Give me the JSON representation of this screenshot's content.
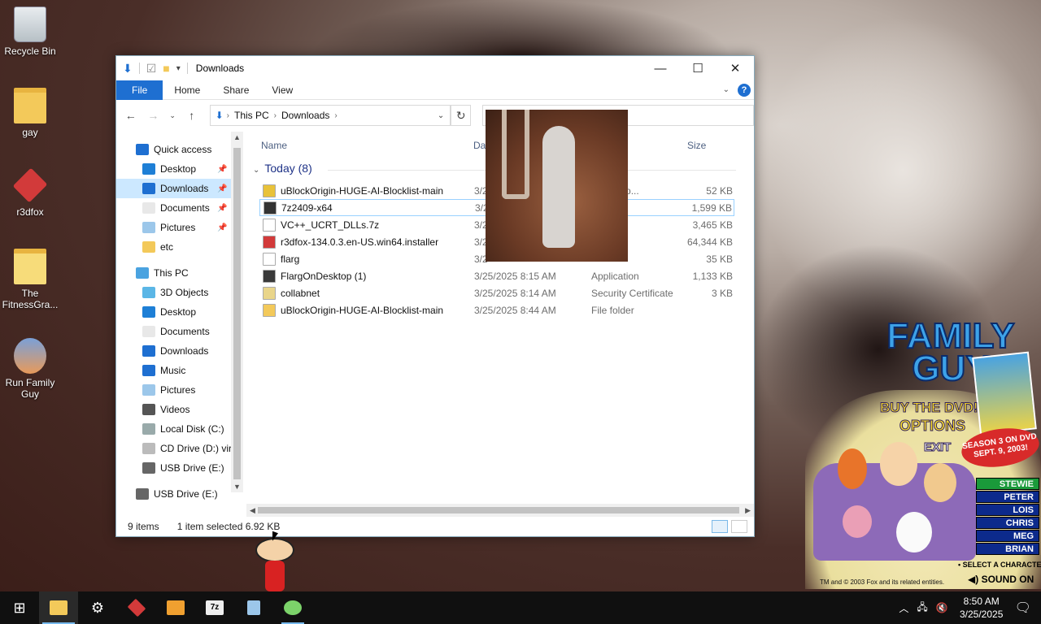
{
  "desktop": {
    "icons": [
      {
        "label": "Recycle Bin",
        "icon": "recycle-bin-icon"
      },
      {
        "label": "gay",
        "icon": "folder-icon"
      },
      {
        "label": "r3dfox",
        "icon": "r3dfox-icon"
      },
      {
        "label": "The FitnessGra...",
        "icon": "file-icon"
      },
      {
        "label": "Run Family Guy",
        "icon": "family-guy-icon"
      }
    ]
  },
  "window": {
    "title": "Downloads",
    "ribbon_tabs": [
      "File",
      "Home",
      "Share",
      "View"
    ],
    "address": {
      "crumbs": [
        "This PC",
        "Downloads"
      ]
    },
    "search_placeholder": ""
  },
  "navpane": {
    "items": [
      {
        "label": "Quick access",
        "icon": "star-icon",
        "level": "top",
        "pinned": false
      },
      {
        "label": "Desktop",
        "icon": "desktop-icon",
        "pinned": true
      },
      {
        "label": "Downloads",
        "icon": "download-icon",
        "pinned": true,
        "selected": true
      },
      {
        "label": "Documents",
        "icon": "documents-icon",
        "pinned": true
      },
      {
        "label": "Pictures",
        "icon": "pictures-icon",
        "pinned": true
      },
      {
        "label": "etc",
        "icon": "folder-icon",
        "pinned": false
      },
      {
        "label": "This PC",
        "icon": "pc-icon",
        "level": "top",
        "pinned": false
      },
      {
        "label": "3D Objects",
        "icon": "cube-icon",
        "pinned": false
      },
      {
        "label": "Desktop",
        "icon": "desktop-icon",
        "pinned": false
      },
      {
        "label": "Documents",
        "icon": "documents-icon",
        "pinned": false
      },
      {
        "label": "Downloads",
        "icon": "download-icon",
        "pinned": false
      },
      {
        "label": "Music",
        "icon": "music-icon",
        "pinned": false
      },
      {
        "label": "Pictures",
        "icon": "pictures-icon",
        "pinned": false
      },
      {
        "label": "Videos",
        "icon": "videos-icon",
        "pinned": false
      },
      {
        "label": "Local Disk (C:)",
        "icon": "disk-icon",
        "pinned": false
      },
      {
        "label": "CD Drive (D:) virt",
        "icon": "cd-icon",
        "pinned": false
      },
      {
        "label": "USB Drive (E:)",
        "icon": "usb-icon",
        "pinned": false
      },
      {
        "label": "USB Drive (E:)",
        "icon": "usb-icon",
        "level": "top",
        "pinned": false
      }
    ]
  },
  "columns": {
    "name": "Name",
    "date": "Dat",
    "size": "Size"
  },
  "group": {
    "label": "Today (8)"
  },
  "files": [
    {
      "name": "uBlockOrigin-HUGE-AI-Blocklist-main",
      "date": "3/2",
      "type": "sed (zipp...",
      "size": "52 KB",
      "icon": "zip-icon",
      "color": "#e8c23a"
    },
    {
      "name": "7z2409-x64",
      "date": "3/2",
      "type": "tion",
      "size": "1,599 KB",
      "icon": "7z-icon",
      "color": "#333333",
      "highlighted": true
    },
    {
      "name": "VC++_UCRT_DLLs.7z",
      "date": "3/2",
      "type": "",
      "size": "3,465 KB",
      "icon": "file-icon",
      "color": "#ffffff"
    },
    {
      "name": "r3dfox-134.0.3.en-US.win64.installer",
      "date": "3/2",
      "type": "tion",
      "size": "64,344 KB",
      "icon": "r3dfox-icon",
      "color": "#d23a3a"
    },
    {
      "name": "flarg",
      "date": "3/2",
      "type": "",
      "size": "35 KB",
      "icon": "file-icon",
      "color": "#ffffff"
    },
    {
      "name": "FlargOnDesktop (1)",
      "date": "3/25/2025 8:15 AM",
      "type": "Application",
      "size": "1,133 KB",
      "icon": "app-icon",
      "color": "#3a3a3a"
    },
    {
      "name": "collabnet",
      "date": "3/25/2025 8:14 AM",
      "type": "Security Certificate",
      "size": "3 KB",
      "icon": "certificate-icon",
      "color": "#e9d58a"
    },
    {
      "name": "uBlockOrigin-HUGE-AI-Blocklist-main",
      "date": "3/25/2025 8:44 AM",
      "type": "File folder",
      "size": "",
      "icon": "folder-icon",
      "color": "#f3c95a"
    }
  ],
  "status": {
    "items": "9 items",
    "selected": "1 item selected  6.92 KB"
  },
  "family_guy_ad": {
    "logo": "FAMILY GUY",
    "buy": "BUY THE DVD!",
    "options": "OPTIONS",
    "exit": "EXIT",
    "season": "SEASON 3 ON DVD SEPT. 9, 2003!",
    "characters": [
      "STEWIE",
      "PETER",
      "LOIS",
      "CHRIS",
      "MEG",
      "BRIAN"
    ],
    "select": "• SELECT A CHARACTER ABOVE",
    "trademark": "TM and © 2003 Fox and its related entities.",
    "sound": "SOUND ON"
  },
  "taskbar": {
    "apps": [
      "start-icon",
      "file-explorer-icon",
      "settings-icon",
      "r3dfox-icon",
      "media-player-icon",
      "7zip-icon",
      "notepad-icon",
      "family-guy-icon"
    ],
    "time": "8:50 AM",
    "date": "3/25/2025"
  }
}
